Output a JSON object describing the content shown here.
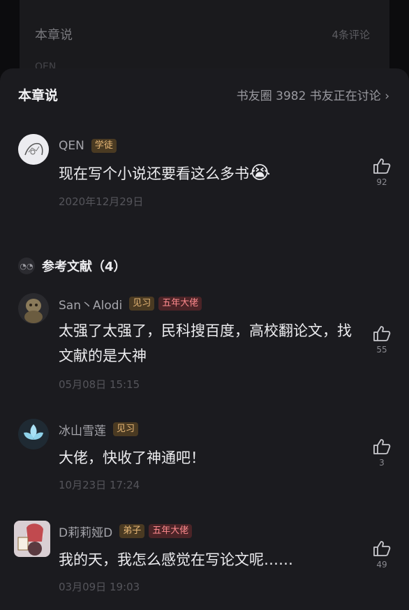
{
  "background": {
    "title": "本章说",
    "count_text": "4条评论",
    "peek_text": "QEN"
  },
  "sheet": {
    "title": "本章说",
    "subtitle": "书友圈 3982 书友正在讨论 ›"
  },
  "top_comment": {
    "user": "QEN",
    "badges": [
      "学徒"
    ],
    "text": "现在写个小说还要看这么多书",
    "emoji": "😭",
    "date": "2020年12月29日",
    "likes": "92"
  },
  "section": {
    "icon_text": "◔◔",
    "title": "参考文献（4）"
  },
  "comments": [
    {
      "user": "San丶Alodi",
      "badges": [
        "见习",
        "五年大佬"
      ],
      "text": "太强了太强了，民科搜百度，高校翻论文，找文献的是大神",
      "date": "05月08日 15:15",
      "likes": "55"
    },
    {
      "user": "冰山雪莲",
      "badges": [
        "见习"
      ],
      "text": "大佬，快收了神通吧！",
      "date": "10月23日 17:24",
      "likes": "3"
    },
    {
      "user": "D莉莉娅D",
      "badges": [
        "弟子",
        "五年大佬"
      ],
      "text": "我的天，我怎么感觉在写论文呢……",
      "date": "03月09日 19:03",
      "likes": "49"
    }
  ],
  "colors": {
    "sheet_bg": "#1b1b1f",
    "badge_gold": "#e8b877",
    "badge_red": "#ff8a8e"
  }
}
